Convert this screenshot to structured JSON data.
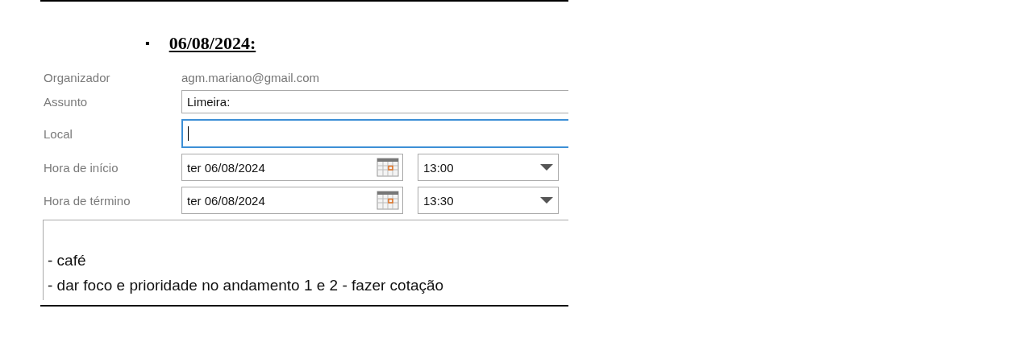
{
  "heading": {
    "bullet": "▪",
    "text": "06/08/2024:"
  },
  "appointment": {
    "fields": [
      {
        "kind": "static",
        "label": "Organizador",
        "value": "agm.mariano@gmail.com"
      },
      {
        "kind": "text",
        "label": "Assunto",
        "value": "Limeira:",
        "focused": false
      },
      {
        "kind": "text",
        "label": "Local",
        "focused": true
      },
      {
        "kind": "datetime",
        "label": "Hora de início",
        "date": "ter 06/08/2024",
        "time": "13:00"
      },
      {
        "kind": "datetime",
        "label": "Hora de término",
        "date": "ter 06/08/2024",
        "time": "13:30"
      }
    ],
    "notes": [
      "- café",
      "- dar foco e prioridade no andamento 1 e 2 - fazer cotação"
    ]
  }
}
